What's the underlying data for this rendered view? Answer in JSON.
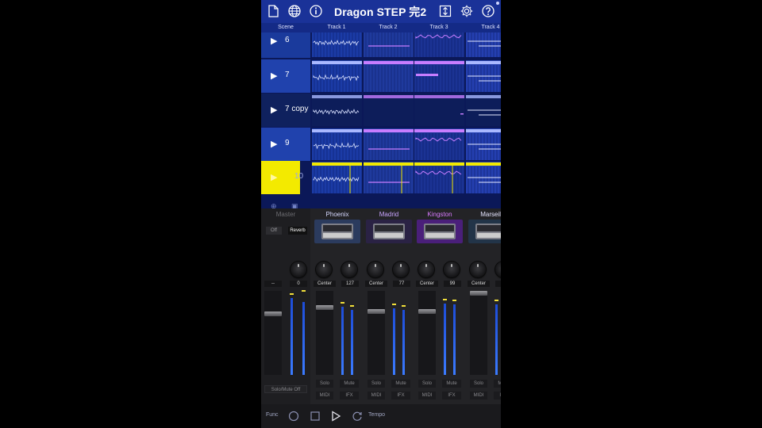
{
  "app": {
    "title": "Dragon STEP 完2"
  },
  "header": {
    "icons": [
      "new-document-icon",
      "globe-icon",
      "info-icon",
      "sort-icon",
      "settings-gear-icon",
      "help-icon"
    ]
  },
  "columns": [
    "Scene",
    "Track 1",
    "Track 2",
    "Track 3",
    "Track 4"
  ],
  "scenes": [
    {
      "label": "6",
      "selected": false
    },
    {
      "label": "7",
      "selected": false
    },
    {
      "label": "7 copy",
      "selected": false
    },
    {
      "label": "9",
      "selected": false
    },
    {
      "label": "10",
      "selected": true
    }
  ],
  "mixer": {
    "master": {
      "name": "Master",
      "reverb_off": "Off",
      "reverb_label": "Reverb",
      "knob_value": "0",
      "left_value": "--",
      "solo_mute_off": "Solo/Mute Off"
    },
    "channels": [
      {
        "name": "Phoenix",
        "pan": "Center",
        "volume": "127",
        "color": "#d5d8ff",
        "accent": "#2b3b5e"
      },
      {
        "name": "Madrid",
        "pan": "Center",
        "volume": "77",
        "color": "#c9a4ff",
        "accent": "#2a2244"
      },
      {
        "name": "Kingston",
        "pan": "Center",
        "volume": "99",
        "color": "#d97bff",
        "accent": "#4a1f7a"
      },
      {
        "name": "Marseill",
        "pan": "Center",
        "volume": "",
        "color": "#e5e5ff",
        "accent": "#223448"
      }
    ],
    "solo_label": "Solo",
    "mute_label": "Mute",
    "midi_label": "MIDI",
    "ifx_label": "IFX"
  },
  "toolbar": {
    "func": "Func",
    "tempo": "Tempo"
  },
  "colors": {
    "header_bg": "#1a3298",
    "highlight": "#f3ea00",
    "clip_blue": "#a9b8ff",
    "clip_violet": "#c77dff"
  }
}
